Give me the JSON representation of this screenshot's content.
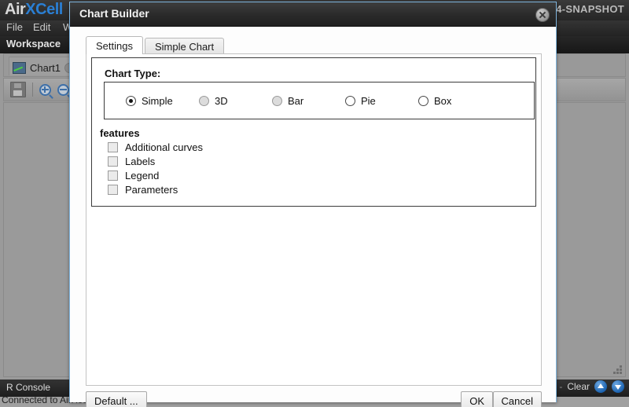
{
  "background": {
    "logo": {
      "part1": "Air",
      "part2": "XCell"
    },
    "version": ".4-SNAPSHOT",
    "menu": [
      {
        "label": "File"
      },
      {
        "label": "Edit"
      },
      {
        "label": "Worl"
      }
    ],
    "subbar_label": "Workspace",
    "tab": {
      "label": "Chart1"
    },
    "console": {
      "title": "R Console",
      "dash": "-",
      "clear_label": "Clear",
      "up_icon": "arrow-up-icon",
      "down_icon": "arrow-down-icon"
    },
    "status_text": "Connected to AirXcell server."
  },
  "dialog": {
    "title": "Chart Builder",
    "close_icon": "close-icon",
    "tabs": [
      {
        "label": "Settings",
        "active": true
      },
      {
        "label": "Simple Chart",
        "active": false
      }
    ],
    "chart_type": {
      "label": "Chart Type:",
      "options": [
        {
          "label": "Simple",
          "selected": true,
          "shaded": false
        },
        {
          "label": "3D",
          "selected": false,
          "shaded": true
        },
        {
          "label": "Bar",
          "selected": false,
          "shaded": true
        },
        {
          "label": "Pie",
          "selected": false,
          "shaded": false
        },
        {
          "label": "Box",
          "selected": false,
          "shaded": false
        }
      ]
    },
    "features": {
      "label": "features",
      "items": [
        {
          "label": "Additional curves",
          "checked": false
        },
        {
          "label": "Labels",
          "checked": false
        },
        {
          "label": "Legend",
          "checked": false
        },
        {
          "label": "Parameters",
          "checked": false
        }
      ]
    },
    "buttons": {
      "default": "Default ...",
      "ok": "OK",
      "cancel": "Cancel"
    }
  },
  "colors": {
    "accent_blue": "#2a7fd4",
    "dialog_border": "#7fb4dd",
    "titlebar_dark": "#2a2a2a",
    "app_bg": "#9a9a9a"
  }
}
